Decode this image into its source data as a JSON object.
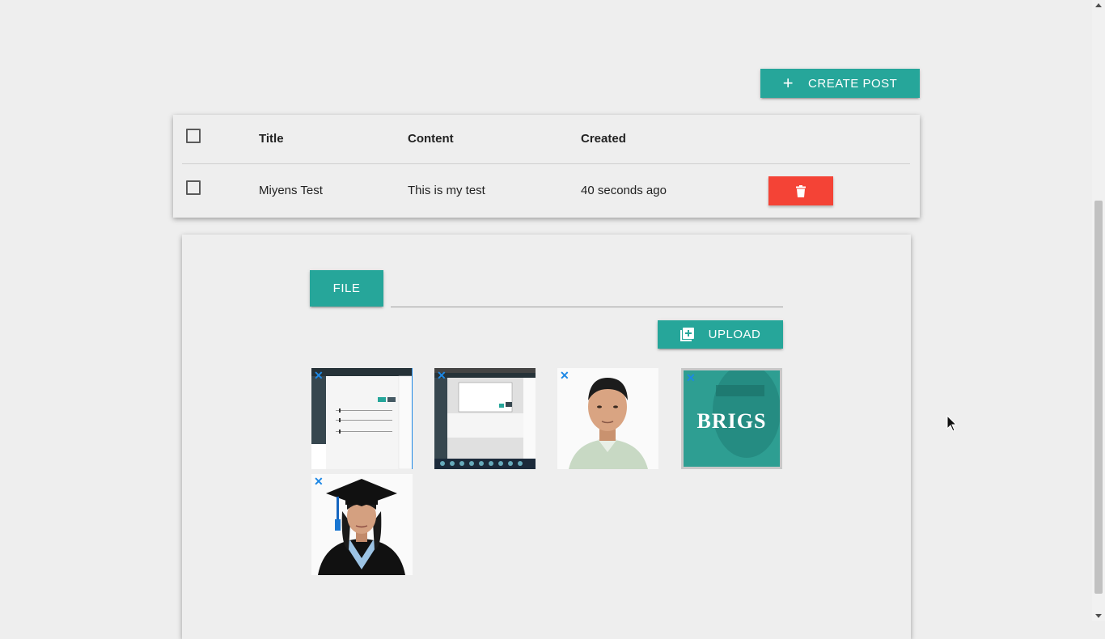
{
  "toolbar": {
    "create_post_label": "CREATE POST",
    "create_post_icon": "plus-icon"
  },
  "table": {
    "headers": [
      "Title",
      "Content",
      "Created"
    ],
    "rows": [
      {
        "title": "Miyens Test",
        "content": "This is my test",
        "created": "40 seconds ago"
      }
    ],
    "delete_icon": "trash-icon"
  },
  "upload": {
    "file_button_label": "FILE",
    "file_path_value": "",
    "upload_button_label": "UPLOAD",
    "upload_icon": "add-to-queue-icon",
    "remove_icon_glyph": "✕",
    "brigs_logo_text": "BRIGS"
  },
  "colors": {
    "accent": "#26a69a",
    "danger": "#f44336",
    "remove_icon": "#1e88e5"
  }
}
